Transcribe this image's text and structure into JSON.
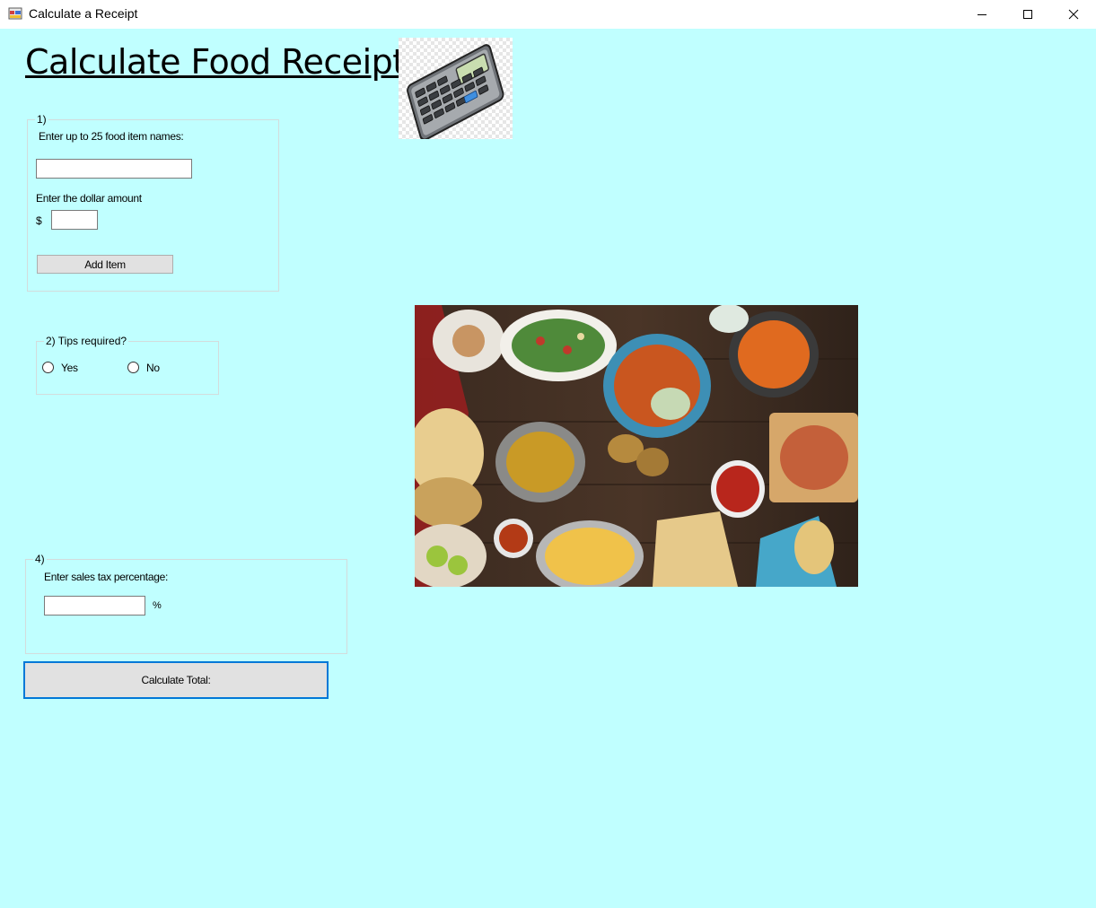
{
  "window": {
    "title": "Calculate a Receipt",
    "minimize_icon": "minimize-icon",
    "maximize_icon": "maximize-icon",
    "close_icon": "close-icon"
  },
  "heading": "Calculate Food Receipt:",
  "images": {
    "calculator": "calculator-illustration",
    "food": "food-spread-photo"
  },
  "group1": {
    "caption": "1)",
    "item_name_label": "Enter up to 25 food item names:",
    "item_name_value": "",
    "amount_label": "Enter the dollar amount",
    "dollar_sign": "$",
    "amount_value": "",
    "add_button": "Add  Item"
  },
  "group2": {
    "caption": "2) Tips required?",
    "yes_label": "Yes",
    "no_label": "No"
  },
  "group4": {
    "caption": "4)",
    "tax_label": "Enter sales tax percentage:",
    "tax_value": "",
    "percent_sign": "%"
  },
  "calculate_button": "Calculate Total:",
  "colors": {
    "form_background": "#c0ffff",
    "focus_border": "#0078d7"
  }
}
